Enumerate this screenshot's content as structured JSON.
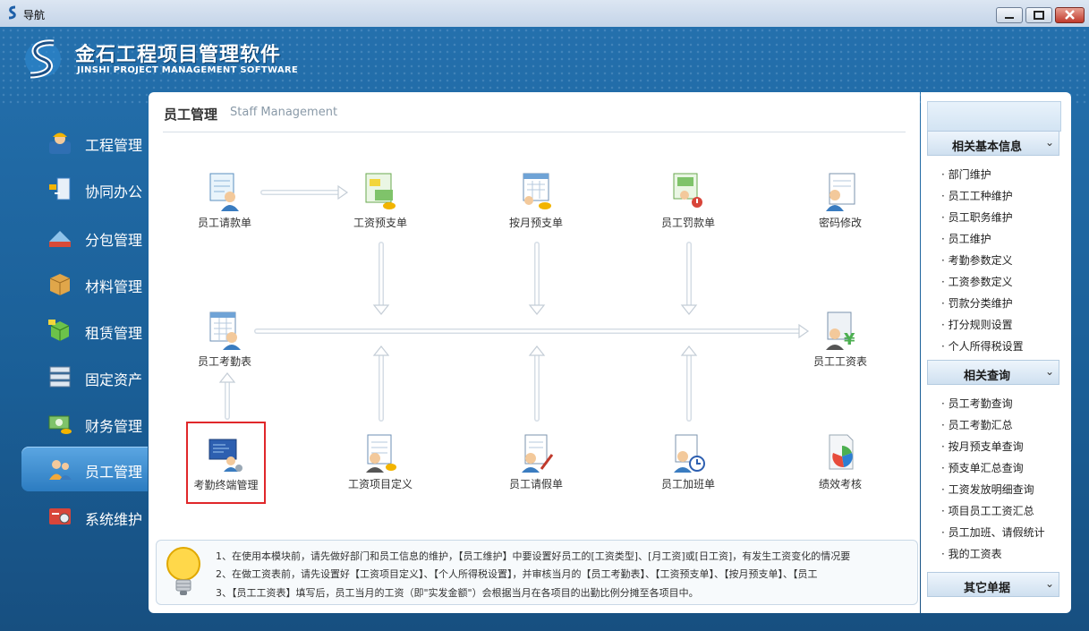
{
  "window": {
    "title": "导航"
  },
  "brand": {
    "cn": "金石工程项目管理软件",
    "en": "JINSHI PROJECT MANAGEMENT SOFTWARE"
  },
  "nav": {
    "items": [
      {
        "label": "工程管理"
      },
      {
        "label": "协同办公"
      },
      {
        "label": "分包管理"
      },
      {
        "label": "材料管理"
      },
      {
        "label": "租赁管理"
      },
      {
        "label": "固定资产"
      },
      {
        "label": "财务管理"
      },
      {
        "label": "员工管理",
        "active": true
      },
      {
        "label": "系统维护"
      }
    ]
  },
  "main": {
    "title": "员工管理",
    "subtitle": "Staff Management",
    "functions": [
      {
        "label": "员工请款单",
        "icon": "loan-request-icon"
      },
      {
        "label": "工资预支单",
        "icon": "salary-advance-icon"
      },
      {
        "label": "按月预支单",
        "icon": "monthly-advance-icon"
      },
      {
        "label": "员工罚款单",
        "icon": "fine-icon"
      },
      {
        "label": "密码修改",
        "icon": "password-icon"
      },
      {
        "label": "员工考勤表",
        "icon": "attendance-sheet-icon"
      },
      {
        "label": "员工工资表",
        "icon": "payroll-icon"
      },
      {
        "label": "考勤终端管理",
        "icon": "attendance-terminal-icon"
      },
      {
        "label": "工资项目定义",
        "icon": "salary-items-icon"
      },
      {
        "label": "员工请假单",
        "icon": "leave-request-icon"
      },
      {
        "label": "员工加班单",
        "icon": "overtime-icon"
      },
      {
        "label": "绩效考核",
        "icon": "performance-icon"
      }
    ],
    "tips": [
      "1、在使用本模块前，请先做好部门和员工信息的维护，【员工维护】中要设置好员工的[工资类型]、[月工资]或[日工资]，有发生工资变化的情况要",
      "2、在做工资表前，请先设置好【工资项目定义】、【个人所得税设置】，并审核当月的【员工考勤表】、【工资预支单】、【按月预支单】、【员工",
      "3、【员工工资表】填写后，员工当月的工资（即\"实发金额\"）会根据当月在各项目的出勤比例分摊至各项目中。"
    ]
  },
  "sidebar": {
    "sections": [
      {
        "title": "相关基本信息",
        "links": [
          "部门维护",
          "员工工种维护",
          "员工职务维护",
          "员工维护",
          "考勤参数定义",
          "工资参数定义",
          "罚款分类维护",
          "打分规则设置",
          "个人所得税设置"
        ]
      },
      {
        "title": "相关查询",
        "links": [
          "员工考勤查询",
          "员工考勤汇总",
          "按月预支单查询",
          "预支单汇总查询",
          "工资发放明细查询",
          "项目员工工资汇总",
          "员工加班、请假统计",
          "我的工资表"
        ]
      },
      {
        "title": "其它单据",
        "links": []
      }
    ]
  },
  "colors": {
    "frame": "#1f6aa5",
    "highlight": "#e0272a",
    "active_nav": "#3b8fd3"
  }
}
